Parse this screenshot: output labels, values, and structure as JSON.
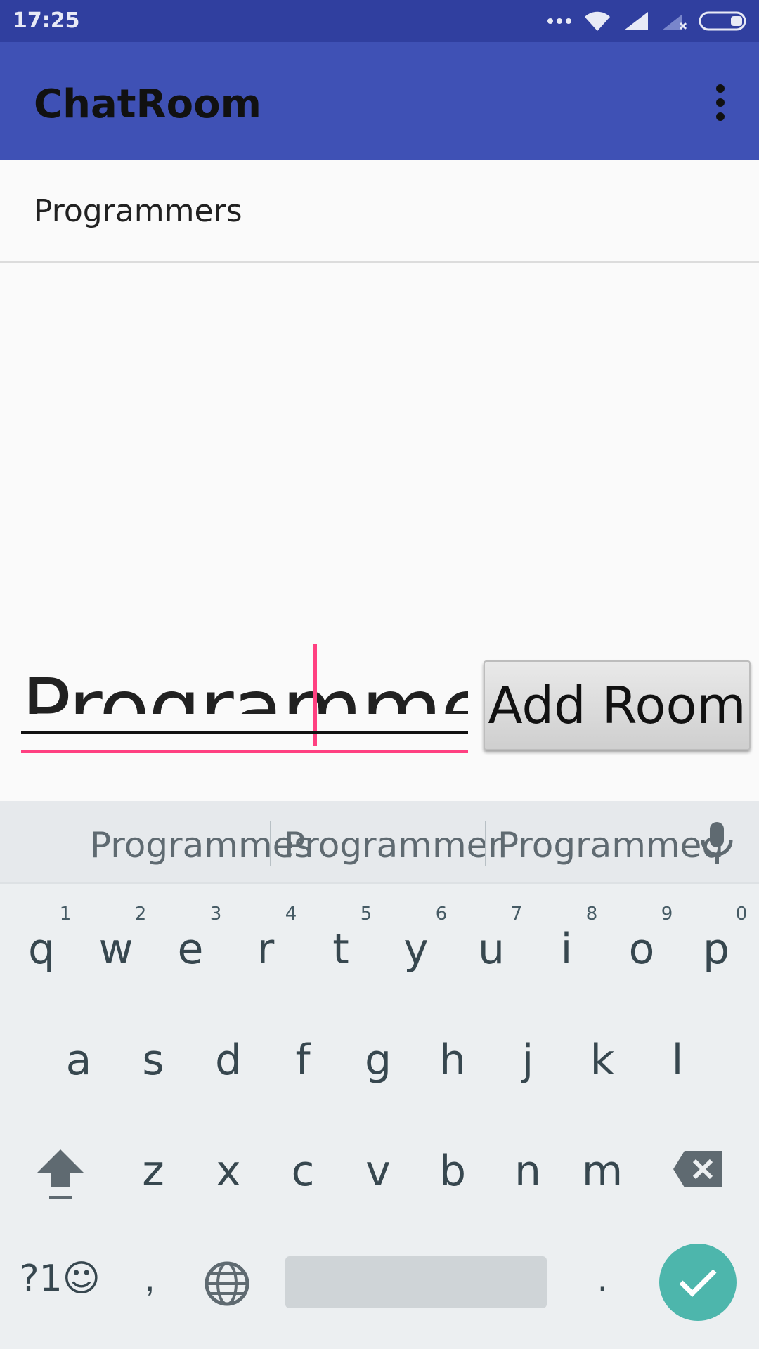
{
  "status_bar": {
    "time": "17:25",
    "icons": [
      "more-dots-icon",
      "wifi-icon",
      "signal-icon",
      "signal-off-icon",
      "battery-icon"
    ]
  },
  "app_bar": {
    "title": "ChatRoom",
    "overflow_icon": "more-vert-icon",
    "background": "#3f51b5"
  },
  "rooms": [
    {
      "name": "Programmers"
    }
  ],
  "room_input": {
    "value": "Programmers",
    "accent": "#ff4081"
  },
  "add_room_button": {
    "label": "Add Room"
  },
  "keyboard": {
    "suggestions": [
      "Programmes",
      "Programmer",
      "Programmed"
    ],
    "row1": [
      {
        "key": "q",
        "hint": "1"
      },
      {
        "key": "w",
        "hint": "2"
      },
      {
        "key": "e",
        "hint": "3"
      },
      {
        "key": "r",
        "hint": "4"
      },
      {
        "key": "t",
        "hint": "5"
      },
      {
        "key": "y",
        "hint": "6"
      },
      {
        "key": "u",
        "hint": "7"
      },
      {
        "key": "i",
        "hint": "8"
      },
      {
        "key": "o",
        "hint": "9"
      },
      {
        "key": "p",
        "hint": "0"
      }
    ],
    "row2": [
      "a",
      "s",
      "d",
      "f",
      "g",
      "h",
      "j",
      "k",
      "l"
    ],
    "row3": [
      "z",
      "x",
      "c",
      "v",
      "b",
      "n",
      "m"
    ],
    "symbols_label": "?1☺",
    "comma": ",",
    "period": ".",
    "enter_color": "#4db6ac"
  }
}
